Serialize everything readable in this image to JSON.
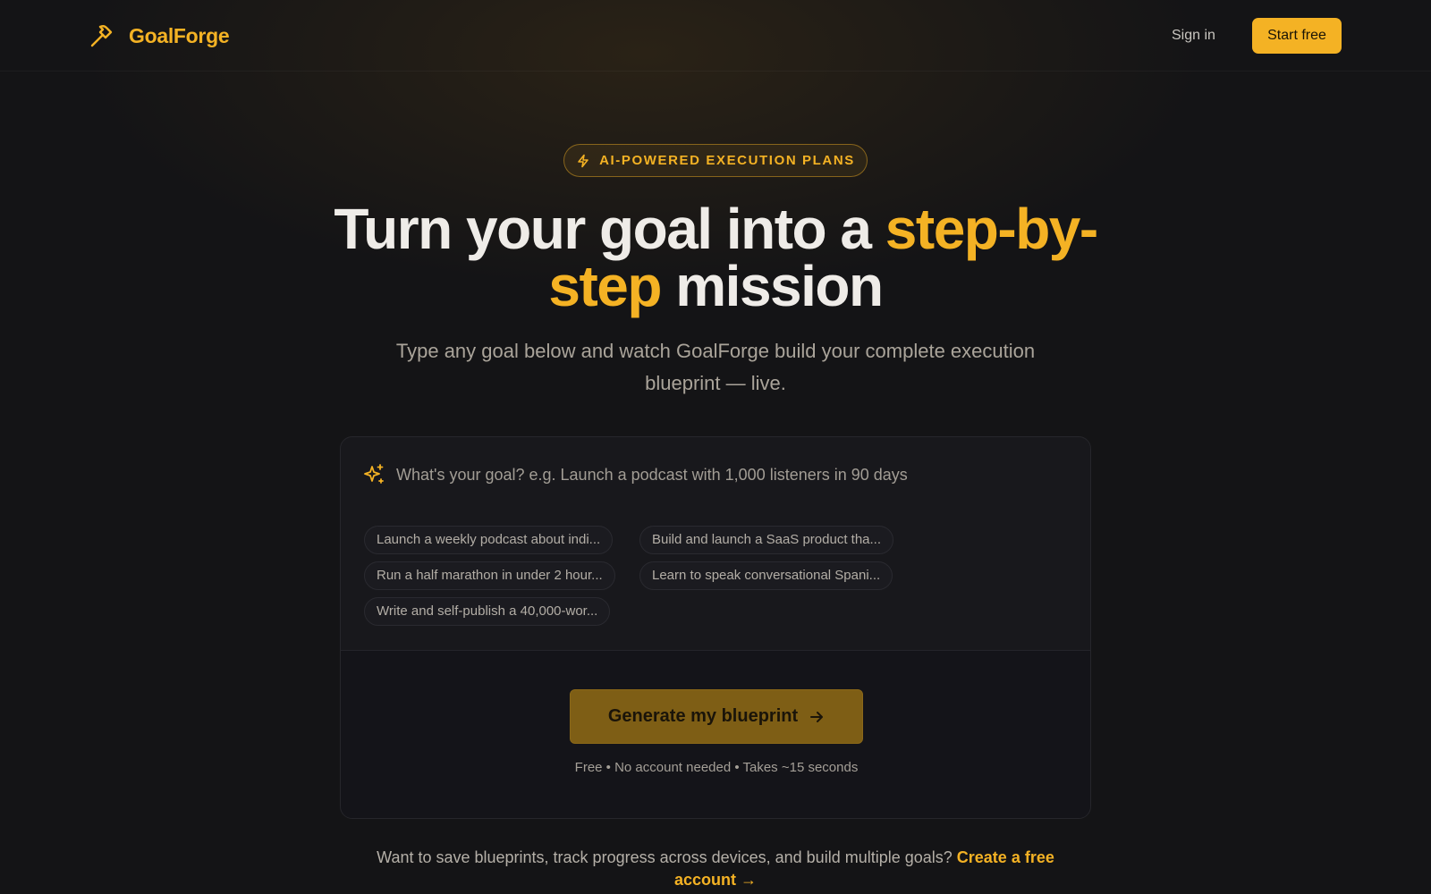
{
  "header": {
    "brand": "GoalForge",
    "logo_icon": "hammer-icon",
    "signin_label": "Sign in",
    "start_label": "Start free"
  },
  "hero": {
    "badge": "AI-POWERED EXECUTION PLANS",
    "badge_icon": "lightning-bolt-icon",
    "headline_part1": "Turn your goal into a ",
    "headline_accent1": "step-by-",
    "headline_accent2": "step",
    "headline_part2": " mission",
    "subtitle": "Type any goal below and watch GoalForge build your complete execution blueprint — live."
  },
  "goal_card": {
    "input_icon": "sparkle-icon",
    "input_placeholder": "What's your goal? e.g. Launch a podcast with 1,000 listeners in 90 days",
    "input_value": "",
    "suggestions": [
      "Launch a weekly podcast about indi...",
      "Build and launch a SaaS product tha...",
      "Run a half marathon in under 2 hour...",
      "Learn to speak conversational Spani...",
      "Write and self-publish a 40,000-wor..."
    ],
    "generate_label": "Generate my blueprint",
    "generate_icon": "arrow-right-icon",
    "note": "Free • No account needed • Takes ~15 seconds"
  },
  "footer": {
    "text": "Want to save blueprints, track progress across devices, and build multiple goals? ",
    "link": "Create a free account →"
  },
  "colors": {
    "accent": "#f4b224",
    "background": "#141416",
    "card": "#18181c",
    "button_disabled": "#7e5e15"
  }
}
